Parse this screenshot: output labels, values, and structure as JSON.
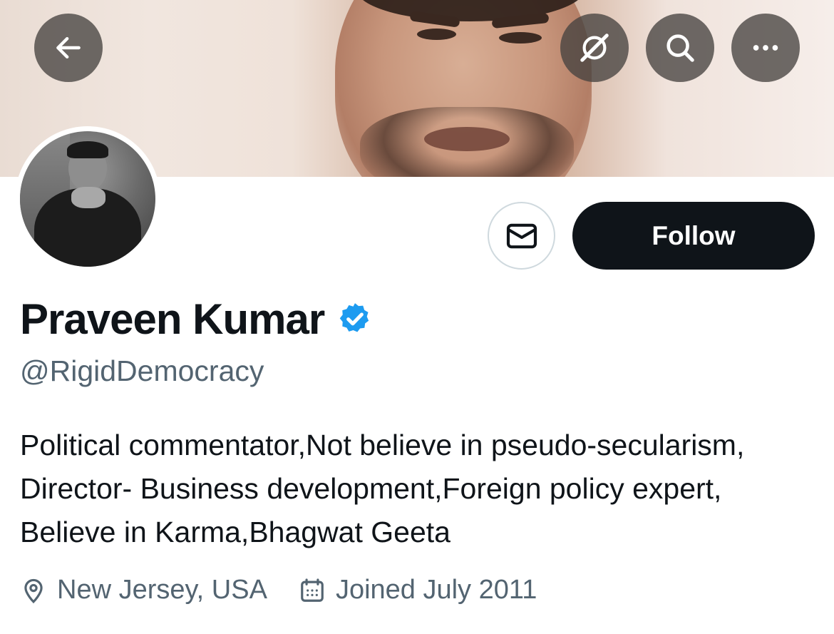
{
  "header": {
    "back_icon": "arrow-left-icon",
    "translate_icon": "grok-icon",
    "search_icon": "search-icon",
    "more_icon": "more-horizontal-icon",
    "button_bg": "#464240"
  },
  "profile": {
    "name": "Praveen Kumar",
    "verified": true,
    "verified_color": "#1d9bf0",
    "handle": "@RigidDemocracy",
    "bio": "Political commentator,Not believe in pseudo-secularism, Director- Business development,Foreign policy expert, Believe in Karma,Bhagwat Geeta",
    "location": "New Jersey, USA",
    "joined": "Joined July 2011"
  },
  "actions": {
    "message_icon": "envelope-icon",
    "follow_label": "Follow"
  },
  "colors": {
    "text_primary": "#0f1419",
    "text_secondary": "#536471",
    "follow_bg": "#0f1419",
    "border": "#cfd9de"
  }
}
